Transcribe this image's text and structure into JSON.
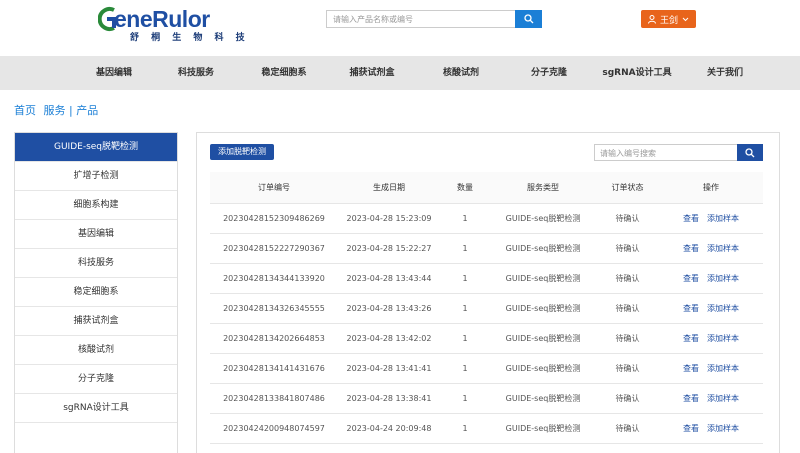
{
  "header": {
    "logo": {
      "text_a": "G",
      "text_b": "ene",
      "text_c": "Rulor",
      "subtitle": "舒 桐 生 物 科 技"
    },
    "search": {
      "placeholder": "请输入产品名称或编号"
    },
    "user": {
      "name": "王剑"
    }
  },
  "nav": {
    "items": [
      "基因编辑",
      "科技服务",
      "稳定细胞系",
      "捕获试剂盒",
      "核酸试剂",
      "分子克隆",
      "sgRNA设计工具",
      "关于我们"
    ]
  },
  "breadcrumb": {
    "home": "首页",
    "section": "服务 | 产品"
  },
  "sidebar": {
    "items": [
      "GUIDE-seq脱靶检测",
      "扩增子检测",
      "细胞系构建",
      "基因编辑",
      "科技服务",
      "稳定细胞系",
      "捕获试剂盒",
      "核酸试剂",
      "分子克隆",
      "sgRNA设计工具"
    ]
  },
  "main": {
    "add_button": "添加脱靶检测",
    "search_placeholder": "请输入编号搜索",
    "table": {
      "headers": [
        "订单编号",
        "生成日期",
        "数量",
        "服务类型",
        "订单状态",
        "操作"
      ],
      "action_view": "查看",
      "action_add": "添加样本",
      "rows": [
        [
          "20230428152309486269",
          "2023-04-28 15:23:09",
          "1",
          "GUIDE-seq脱靶检测",
          "待确认"
        ],
        [
          "20230428152227290367",
          "2023-04-28 15:22:27",
          "1",
          "GUIDE-seq脱靶检测",
          "待确认"
        ],
        [
          "20230428134344133920",
          "2023-04-28 13:43:44",
          "1",
          "GUIDE-seq脱靶检测",
          "待确认"
        ],
        [
          "20230428134326345555",
          "2023-04-28 13:43:26",
          "1",
          "GUIDE-seq脱靶检测",
          "待确认"
        ],
        [
          "20230428134202664853",
          "2023-04-28 13:42:02",
          "1",
          "GUIDE-seq脱靶检测",
          "待确认"
        ],
        [
          "20230428134141431676",
          "2023-04-28 13:41:41",
          "1",
          "GUIDE-seq脱靶检测",
          "待确认"
        ],
        [
          "20230428133841807486",
          "2023-04-28 13:38:41",
          "1",
          "GUIDE-seq脱靶检测",
          "待确认"
        ],
        [
          "20230424200948074597",
          "2023-04-24 20:09:48",
          "1",
          "GUIDE-seq脱靶检测",
          "待确认"
        ]
      ]
    }
  },
  "colors": {
    "brand_blue": "#1f4fa3",
    "search_blue": "#1b7fd6",
    "user_orange": "#e8641b",
    "logo_green": "#2a8a3a"
  }
}
